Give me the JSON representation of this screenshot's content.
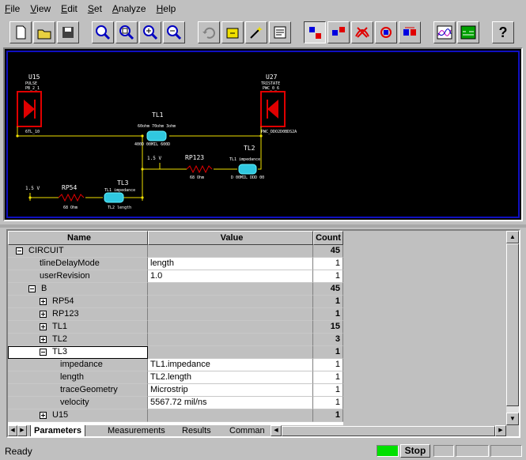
{
  "menu": [
    {
      "label": "File",
      "accel": "F"
    },
    {
      "label": "View",
      "accel": "V"
    },
    {
      "label": "Edit",
      "accel": "E"
    },
    {
      "label": "Set",
      "accel": "S"
    },
    {
      "label": "Analyze",
      "accel": "A"
    },
    {
      "label": "Help",
      "accel": "H"
    }
  ],
  "toolbar": {
    "buttons": [
      "new-file-icon",
      "open-folder-icon",
      "save-icon",
      "zoom-fit-icon",
      "zoom-area-icon",
      "zoom-in-icon",
      "zoom-out-icon",
      "undo-icon",
      "edit-part-icon",
      "wizard-icon",
      "properties-icon",
      "select-mode-icon",
      "move-icon",
      "delete-icon",
      "rotate-icon",
      "swap-icon",
      "waveform-icon",
      "simulate-icon",
      "help-icon"
    ],
    "help_label": "?"
  },
  "schematic": {
    "u15": {
      "name": "U15",
      "model": "PULSE",
      "model2": "PB_2_1",
      "pin": "6TL_10"
    },
    "u27": {
      "name": "U27",
      "model": "TRISTATE",
      "model2": "PWC_0_6",
      "pin": "PWC_DDO2D0BDS2A"
    },
    "tl1": {
      "name": "TL1",
      "line1": "60ohm 70ohm 3ohm",
      "line2": "400D 00MIL 600D"
    },
    "tl2": {
      "name": "TL2",
      "line1": "TL1 impedance",
      "line2": "D 00MIL DDD 00"
    },
    "tl3": {
      "name": "TL3",
      "line1": "TL1 impedance",
      "line2": "TL2 length"
    },
    "rp123": {
      "name": "RP123",
      "value": "68 Ohm"
    },
    "rp54": {
      "name": "RP54",
      "value": "68 Ohm"
    },
    "vsrc1": "1.5 V",
    "vsrc2": "1.5 V"
  },
  "grid": {
    "headers": {
      "name": "Name",
      "value": "Value",
      "count": "Count"
    },
    "rows": [
      {
        "name": "CIRCUIT",
        "value": "",
        "count": "45",
        "level": 0,
        "toggle": "minus",
        "bold_count": true
      },
      {
        "name": "tlineDelayMode",
        "value": "length",
        "count": "1",
        "level": 2,
        "toggle": ""
      },
      {
        "name": "userRevision",
        "value": "1.0",
        "count": "1",
        "level": 2,
        "toggle": ""
      },
      {
        "name": "B",
        "value": "",
        "count": "45",
        "level": 1,
        "toggle": "minus",
        "bold_count": true
      },
      {
        "name": "RP54",
        "value": "",
        "count": "1",
        "level": 2,
        "toggle": "plus",
        "bold_count": true
      },
      {
        "name": "RP123",
        "value": "",
        "count": "1",
        "level": 2,
        "toggle": "plus",
        "bold_count": true
      },
      {
        "name": "TL1",
        "value": "",
        "count": "15",
        "level": 2,
        "toggle": "plus",
        "bold_count": true
      },
      {
        "name": "TL2",
        "value": "",
        "count": "3",
        "level": 2,
        "toggle": "plus",
        "bold_count": true
      },
      {
        "name": "TL3",
        "value": "",
        "count": "1",
        "level": 2,
        "toggle": "minus",
        "bold_count": true,
        "focused": true
      },
      {
        "name": "impedance",
        "value": "TL1.impedance",
        "count": "1",
        "level": 3,
        "toggle": ""
      },
      {
        "name": "length",
        "value": "TL2.length",
        "count": "1",
        "level": 3,
        "toggle": ""
      },
      {
        "name": "traceGeometry",
        "value": "Microstrip",
        "count": "1",
        "level": 3,
        "toggle": ""
      },
      {
        "name": "velocity",
        "value": "5567.72 mil/ns",
        "count": "1",
        "level": 3,
        "toggle": ""
      },
      {
        "name": "U15",
        "value": "",
        "count": "1",
        "level": 2,
        "toggle": "plus",
        "bold_count": true
      }
    ]
  },
  "tabs": [
    "Parameters",
    "Measurements",
    "Results",
    "Comman"
  ],
  "active_tab": "Parameters",
  "status": {
    "text": "Ready",
    "stop_label": "Stop"
  }
}
